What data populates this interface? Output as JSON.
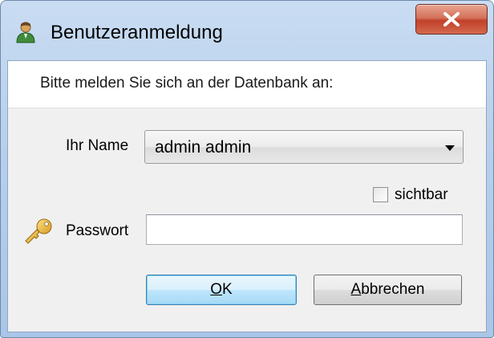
{
  "window": {
    "title": "Benutzeranmeldung",
    "title_icon": "user-icon",
    "close_icon": "close-icon"
  },
  "header": {
    "instruction": "Bitte melden Sie sich an der Datenbank an:"
  },
  "form": {
    "name_label": "Ihr Name",
    "name_value": "admin admin",
    "visible_checkbox_label": "sichtbar",
    "visible_checked": false,
    "password_label": "Passwort",
    "password_value": "",
    "password_icon": "key-icon"
  },
  "buttons": {
    "ok_mnemonic": "O",
    "ok_rest": "K",
    "cancel_mnemonic": "A",
    "cancel_rest": "bbrechen"
  },
  "colors": {
    "close_button": "#c7432c",
    "ok_button_highlight": "#3c7fb1"
  }
}
